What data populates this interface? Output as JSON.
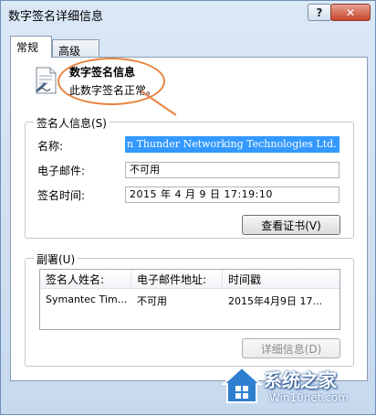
{
  "window": {
    "title": "数字签名详细信息",
    "help_label": "?",
    "close_label": "✕"
  },
  "tabs": [
    {
      "label": "常规"
    },
    {
      "label": "高级"
    }
  ],
  "signature_info": {
    "title": "数字签名信息",
    "status": "此数字签名正常。"
  },
  "signer": {
    "group_label": "签名人信息(S)",
    "name_label": "名称:",
    "name_value": "n Thunder Networking Technologies Ltd.",
    "email_label": "电子邮件:",
    "email_value": "不可用",
    "time_label": "签名时间:",
    "time_value": "2015  年  4  月  9  日  17:19:10",
    "view_cert_button": "查看证书(V)"
  },
  "countersignatures": {
    "group_label": "副署(U)",
    "columns": [
      "签名人姓名:",
      "电子邮件地址:",
      "时间戳"
    ],
    "rows": [
      [
        "Symantec Tim...",
        "不可用",
        "2015年4月9日 17..."
      ]
    ],
    "details_button": "详细信息(D)"
  },
  "watermark": {
    "brand": "系统之家",
    "url": "Win10net.com"
  },
  "colors": {
    "selection": "#3399ff",
    "callout": "#e88443",
    "close": "#c7452e"
  }
}
